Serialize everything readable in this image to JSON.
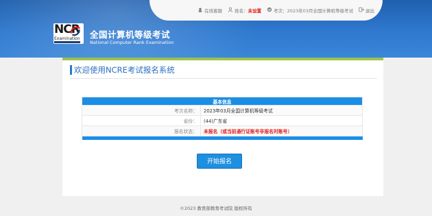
{
  "topbar": {
    "online_help": "在线客服",
    "name_label": "姓名：",
    "name_value": "未设置",
    "exam_label": "考次：",
    "exam_value": "2023年03月全国计算机等级考试",
    "logout": "退出"
  },
  "logo": {
    "big_text": "NCR",
    "sub_text": "Examination"
  },
  "header": {
    "title_cn": "全国计算机等级考试",
    "title_en": "National Computer Rank Examination"
  },
  "main": {
    "welcome": "欢迎使用NCRE考试报名系统",
    "table_title": "基本信息",
    "rows": [
      {
        "label": "考次名称：",
        "value": "2023年03月全国计算机等级考试"
      },
      {
        "label": "省份：",
        "value": "(44)广东省"
      },
      {
        "label": "报名状态：",
        "value": "未报名（或当前通行证账号非报名时账号）"
      }
    ],
    "start_button": "开始报名"
  },
  "footer": {
    "text": "©2023  教育部教育考试院  版权所有"
  },
  "colors": {
    "header_blue": "#2f79cf",
    "accent_green": "#9bc34a",
    "table_blue": "#1a8ee6",
    "button_blue": "#1f8fe0",
    "alert_red": "#e21b1b"
  },
  "icons": {
    "online_help": "headset-icon",
    "name": "user-icon",
    "exam": "exam-icon",
    "logout": "logout-icon"
  }
}
